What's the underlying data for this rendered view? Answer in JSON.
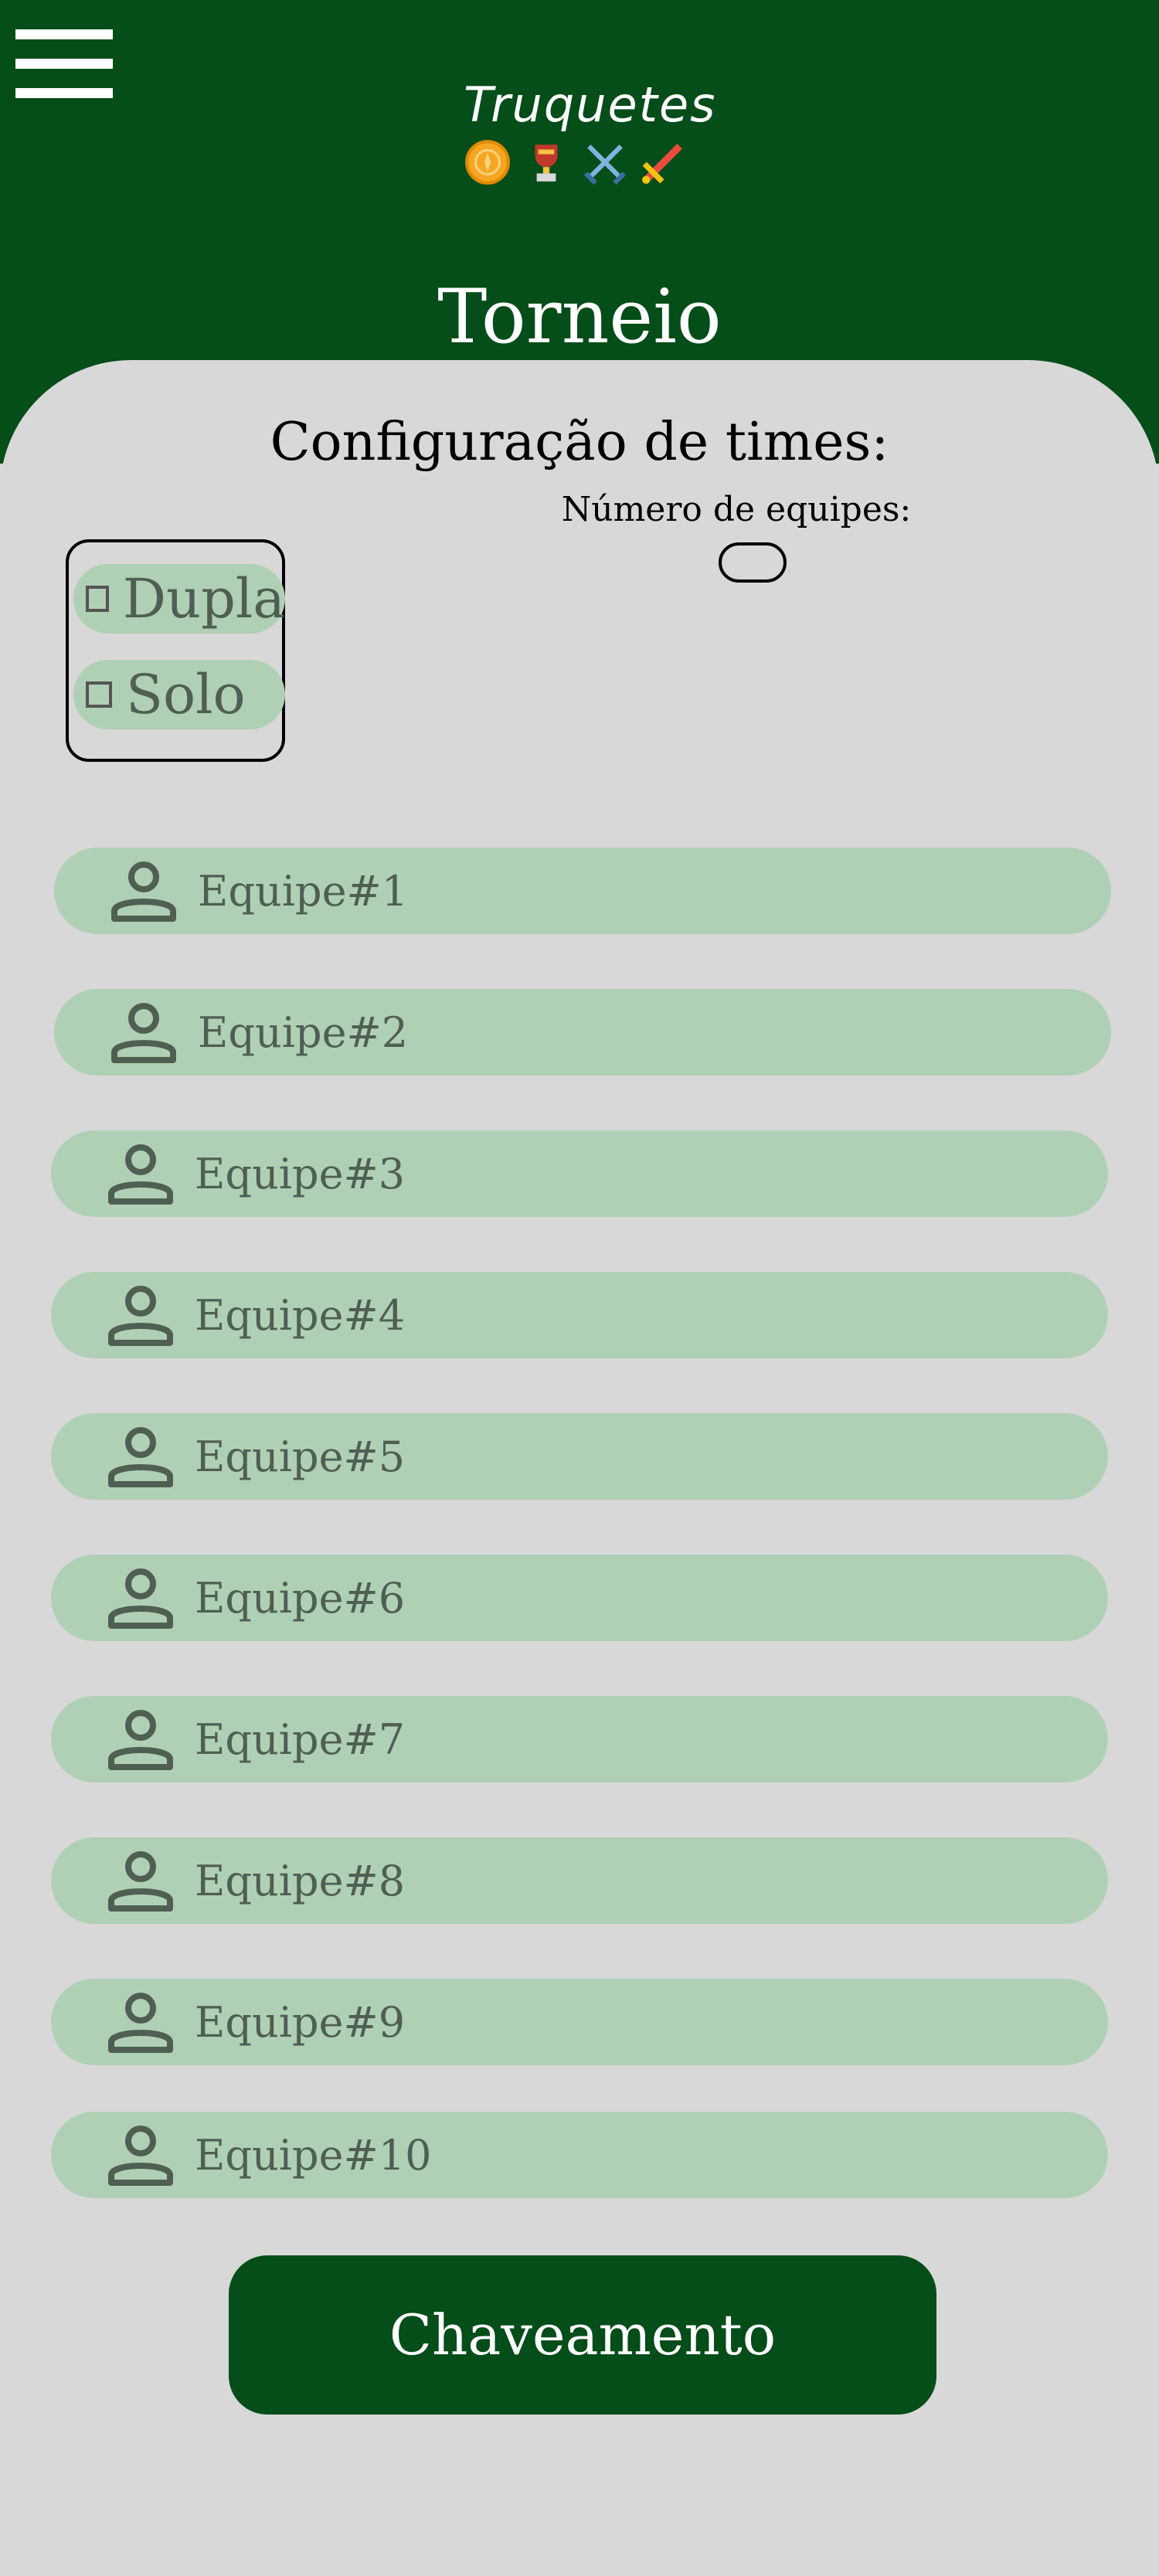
{
  "header": {
    "logo_text": "Truquetes",
    "logo_icons": [
      "coin-icon",
      "trophy-icon",
      "crossed-swords-icon",
      "sword-icon"
    ],
    "page_title": "Torneio",
    "background_color": "#054d19"
  },
  "config": {
    "title": "Configuração de times:",
    "num_teams_label": "Número de equipes:",
    "num_teams_value": "",
    "modes": [
      {
        "label": "Dupla",
        "checked": false
      },
      {
        "label": "Solo",
        "checked": false
      }
    ]
  },
  "teams": [
    {
      "label": "Equipe#1"
    },
    {
      "label": "Equipe#2"
    },
    {
      "label": "Equipe#3"
    },
    {
      "label": "Equipe#4"
    },
    {
      "label": "Equipe#5"
    },
    {
      "label": "Equipe#6"
    },
    {
      "label": "Equipe#7"
    },
    {
      "label": "Equipe#8"
    },
    {
      "label": "Equipe#9"
    },
    {
      "label": "Equipe#10"
    }
  ],
  "actions": {
    "bracket_button_label": "Chaveamento"
  },
  "colors": {
    "accent_green": "#054d19",
    "pill_green": "#afd0b4",
    "panel_gray": "#d8d8d8"
  }
}
